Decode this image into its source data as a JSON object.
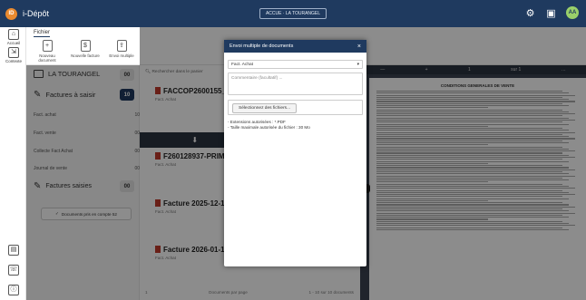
{
  "app": {
    "logo": "ID",
    "name": "i-Dépôt",
    "search_label": "ACCUE · LA TOURANGEL"
  },
  "top_icons": {
    "gear": "⚙",
    "window": "▣",
    "avatar": "AA"
  },
  "left_rail": [
    {
      "label": "Accueil",
      "icon": "⌂"
    },
    {
      "label": "Contexte",
      "icon": "⇲"
    }
  ],
  "left_rail_bottom": [
    {
      "icon": "▤"
    },
    {
      "icon": "☏"
    },
    {
      "icon": "ⓘ"
    }
  ],
  "ribbon": {
    "tab": "Fichier",
    "buttons": [
      {
        "label": "Nouveau document",
        "icon": "+"
      },
      {
        "label": "Nouvelle facture",
        "icon": "$"
      },
      {
        "label": "Envoi multiple",
        "icon": "⇪"
      }
    ]
  },
  "folders": {
    "root": {
      "label": "LA TOURANGEL",
      "count": "00"
    },
    "saisir": {
      "label": "Factures à saisir",
      "count": "10"
    },
    "items": [
      {
        "label": "Fact. achat",
        "count": "10"
      },
      {
        "label": "Fact. vente",
        "count": "00"
      },
      {
        "label": "Collecte Fact Achat",
        "count": "00"
      },
      {
        "label": "Journal de vente",
        "count": "00"
      }
    ],
    "saisies": {
      "label": "Factures saisies",
      "count": "00"
    },
    "pill": "Documents pris en compte  52"
  },
  "middle": {
    "search": "Rechercher dans le panier",
    "documents": [
      {
        "title": "FACCOP2600155_2.PDF",
        "sub": "Fact. Achat"
      },
      {
        "title": "F260128937-PRIMACOU",
        "sub": "Fact. Achat"
      },
      {
        "title": "Facture 2025-12-15.pdf",
        "sub": "Fact. Achat"
      },
      {
        "title": "Facture 2026-01-14 - 1",
        "sub": "Fact. Achat"
      }
    ],
    "darkbar_icons": [
      "⬇",
      "✎"
    ],
    "footer_left": "1",
    "footer_mid": "Documents par page",
    "footer_right": "1 - 10 sur 10 documents"
  },
  "viewer": {
    "toolbar": [
      "—",
      "+",
      "1",
      "sur 1",
      "…"
    ],
    "page_title": "CONDITIONS GENERALES DE VENTE"
  },
  "modal": {
    "title": "Envoi multiple de documents",
    "close": "×",
    "select_value": "Fact. Achat",
    "comment_placeholder": "Commentaire (facultatif) ...",
    "file_button": "Sélectionnez des fichiers...",
    "info_line1": "- Extensions autorisées : *.PDF",
    "info_line2": "- Taille maximale autorisée du fichier : 30 Mo"
  }
}
